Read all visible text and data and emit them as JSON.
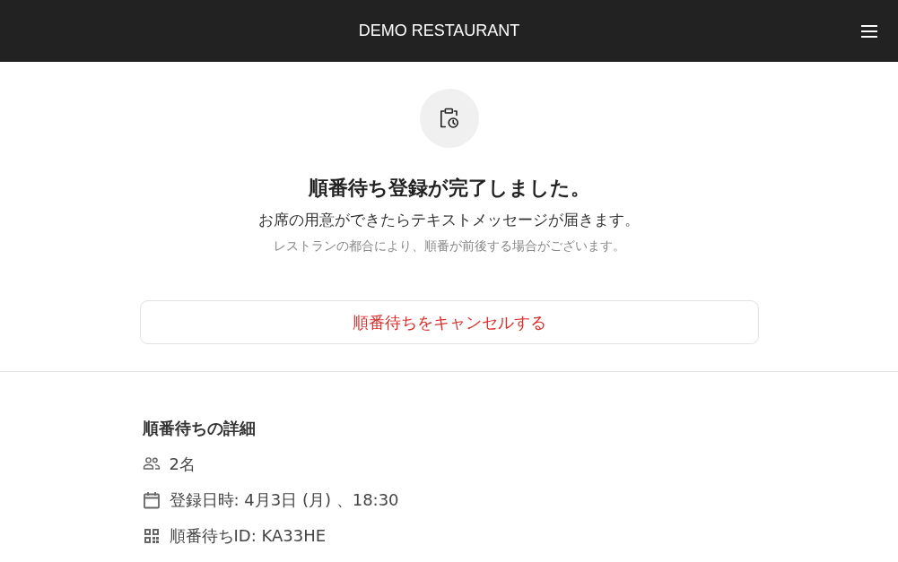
{
  "header": {
    "title": "DEMO RESTAURANT"
  },
  "confirmation": {
    "heading": "順番待ち登録が完了しました。",
    "message": "お席の用意ができたらテキストメッセージが届きます。",
    "note": "レストランの都合により、順番が前後する場合がございます。"
  },
  "cancel_button": {
    "label": "順番待ちをキャンセルする"
  },
  "details": {
    "title": "順番待ちの詳細",
    "items": [
      {
        "kind": "guests",
        "text": "2名"
      },
      {
        "kind": "date",
        "text": "登録日時: 4月3日 (月) 、18:30"
      },
      {
        "kind": "id",
        "text": "順番待ちID: KA33HE"
      }
    ]
  }
}
